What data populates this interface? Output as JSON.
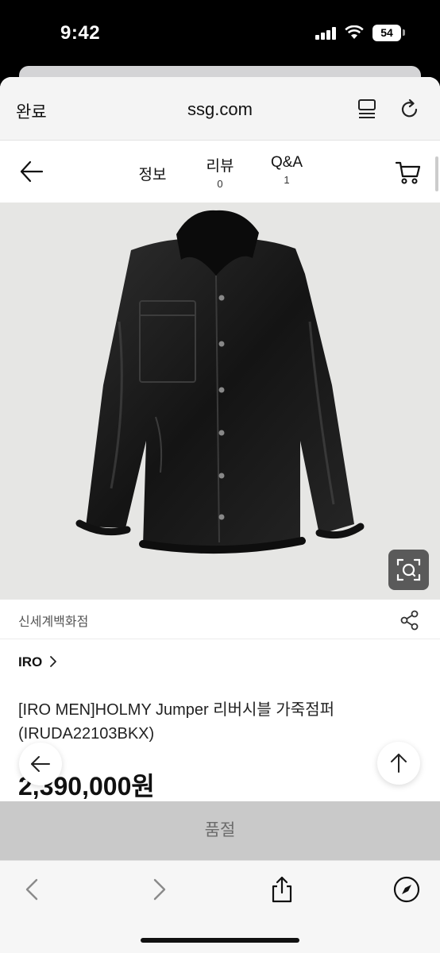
{
  "status_bar": {
    "time": "9:42",
    "battery": "54"
  },
  "browser": {
    "done_label": "완료",
    "url": "ssg.com"
  },
  "nav": {
    "tabs": [
      {
        "label": "정보",
        "count": ""
      },
      {
        "label": "리뷰",
        "count": "0"
      },
      {
        "label": "Q&A",
        "count": "1"
      }
    ]
  },
  "product": {
    "seller": "신세계백화점",
    "brand": "IRO",
    "title": "[IRO MEN]HOLMY Jumper 리버시블 가죽점퍼(IRUDA22103BKX)",
    "price": "2,390,000원",
    "soldout_label": "품절"
  },
  "icons": {
    "reader": "reader-icon",
    "reload": "reload-icon",
    "back": "arrow-left-icon",
    "cart": "cart-icon",
    "image_search": "lens-icon",
    "share": "share-icon",
    "scroll_top": "arrow-up-icon",
    "safari_back": "chevron-left-icon",
    "safari_forward": "chevron-right-icon",
    "safari_share": "share-box-icon",
    "compass": "compass-icon"
  },
  "colors": {
    "soldout_bg": "#c9c9c9",
    "image_bg": "#e6e6e4"
  }
}
